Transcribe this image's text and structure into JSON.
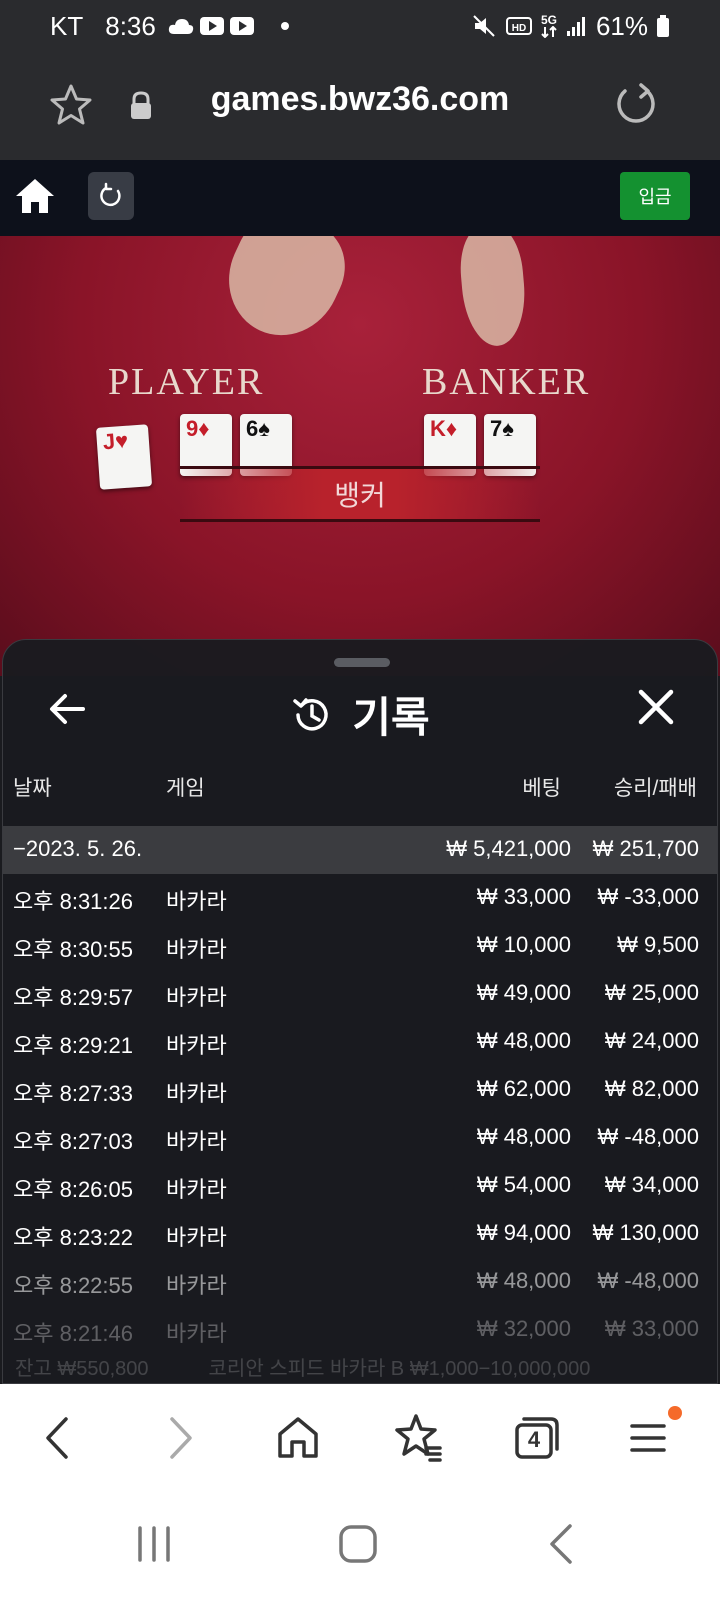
{
  "status_bar": {
    "carrier": "KT",
    "time": "8:36",
    "battery": "61%",
    "network": "5G"
  },
  "browser": {
    "url": "games.bwz36.com"
  },
  "site": {
    "deposit_label": "입금"
  },
  "game_video": {
    "player_label": "PLAYER",
    "banker_label": "BANKER",
    "result_text": "뱅커",
    "player_cards": [
      {
        "rank": "J",
        "suit": "♥",
        "color": "red"
      },
      {
        "rank": "9",
        "suit": "♦",
        "color": "red"
      },
      {
        "rank": "6",
        "suit": "♠",
        "color": "black"
      }
    ],
    "banker_cards": [
      {
        "rank": "K",
        "suit": "♦",
        "color": "red"
      },
      {
        "rank": "7",
        "suit": "♠",
        "color": "black"
      }
    ]
  },
  "history": {
    "title": "기록",
    "columns": {
      "date": "날짜",
      "game": "게임",
      "bet": "베팅",
      "win_loss": "승리/패배"
    },
    "summary": {
      "date": "−2023. 5. 26.",
      "bet": "₩ 5,421,000",
      "win_loss": "₩ 251,700"
    },
    "rows": [
      {
        "time": "오후 8:31:26",
        "game": "바카라",
        "bet": "₩ 33,000",
        "win_loss": "₩ -33,000"
      },
      {
        "time": "오후 8:30:55",
        "game": "바카라",
        "bet": "₩ 10,000",
        "win_loss": "₩ 9,500"
      },
      {
        "time": "오후 8:29:57",
        "game": "바카라",
        "bet": "₩ 49,000",
        "win_loss": "₩ 25,000"
      },
      {
        "time": "오후 8:29:21",
        "game": "바카라",
        "bet": "₩ 48,000",
        "win_loss": "₩ 24,000"
      },
      {
        "time": "오후 8:27:33",
        "game": "바카라",
        "bet": "₩ 62,000",
        "win_loss": "₩ 82,000"
      },
      {
        "time": "오후 8:27:03",
        "game": "바카라",
        "bet": "₩ 48,000",
        "win_loss": "₩ -48,000"
      },
      {
        "time": "오후 8:26:05",
        "game": "바카라",
        "bet": "₩ 54,000",
        "win_loss": "₩ 34,000"
      },
      {
        "time": "오후 8:23:22",
        "game": "바카라",
        "bet": "₩ 94,000",
        "win_loss": "₩ 130,000"
      },
      {
        "time": "오후 8:22:55",
        "game": "바카라",
        "bet": "₩ 48,000",
        "win_loss": "₩ -48,000"
      },
      {
        "time": "오후 8:21:46",
        "game": "바카라",
        "bet": "₩ 32,000",
        "win_loss": "₩ 33,000"
      }
    ],
    "background_balance": "잔고 ₩550,800",
    "background_table": "코리안 스피드 바카라 B  ₩1,000−10,000,000"
  },
  "browser_nav": {
    "tabs_count": "4"
  }
}
